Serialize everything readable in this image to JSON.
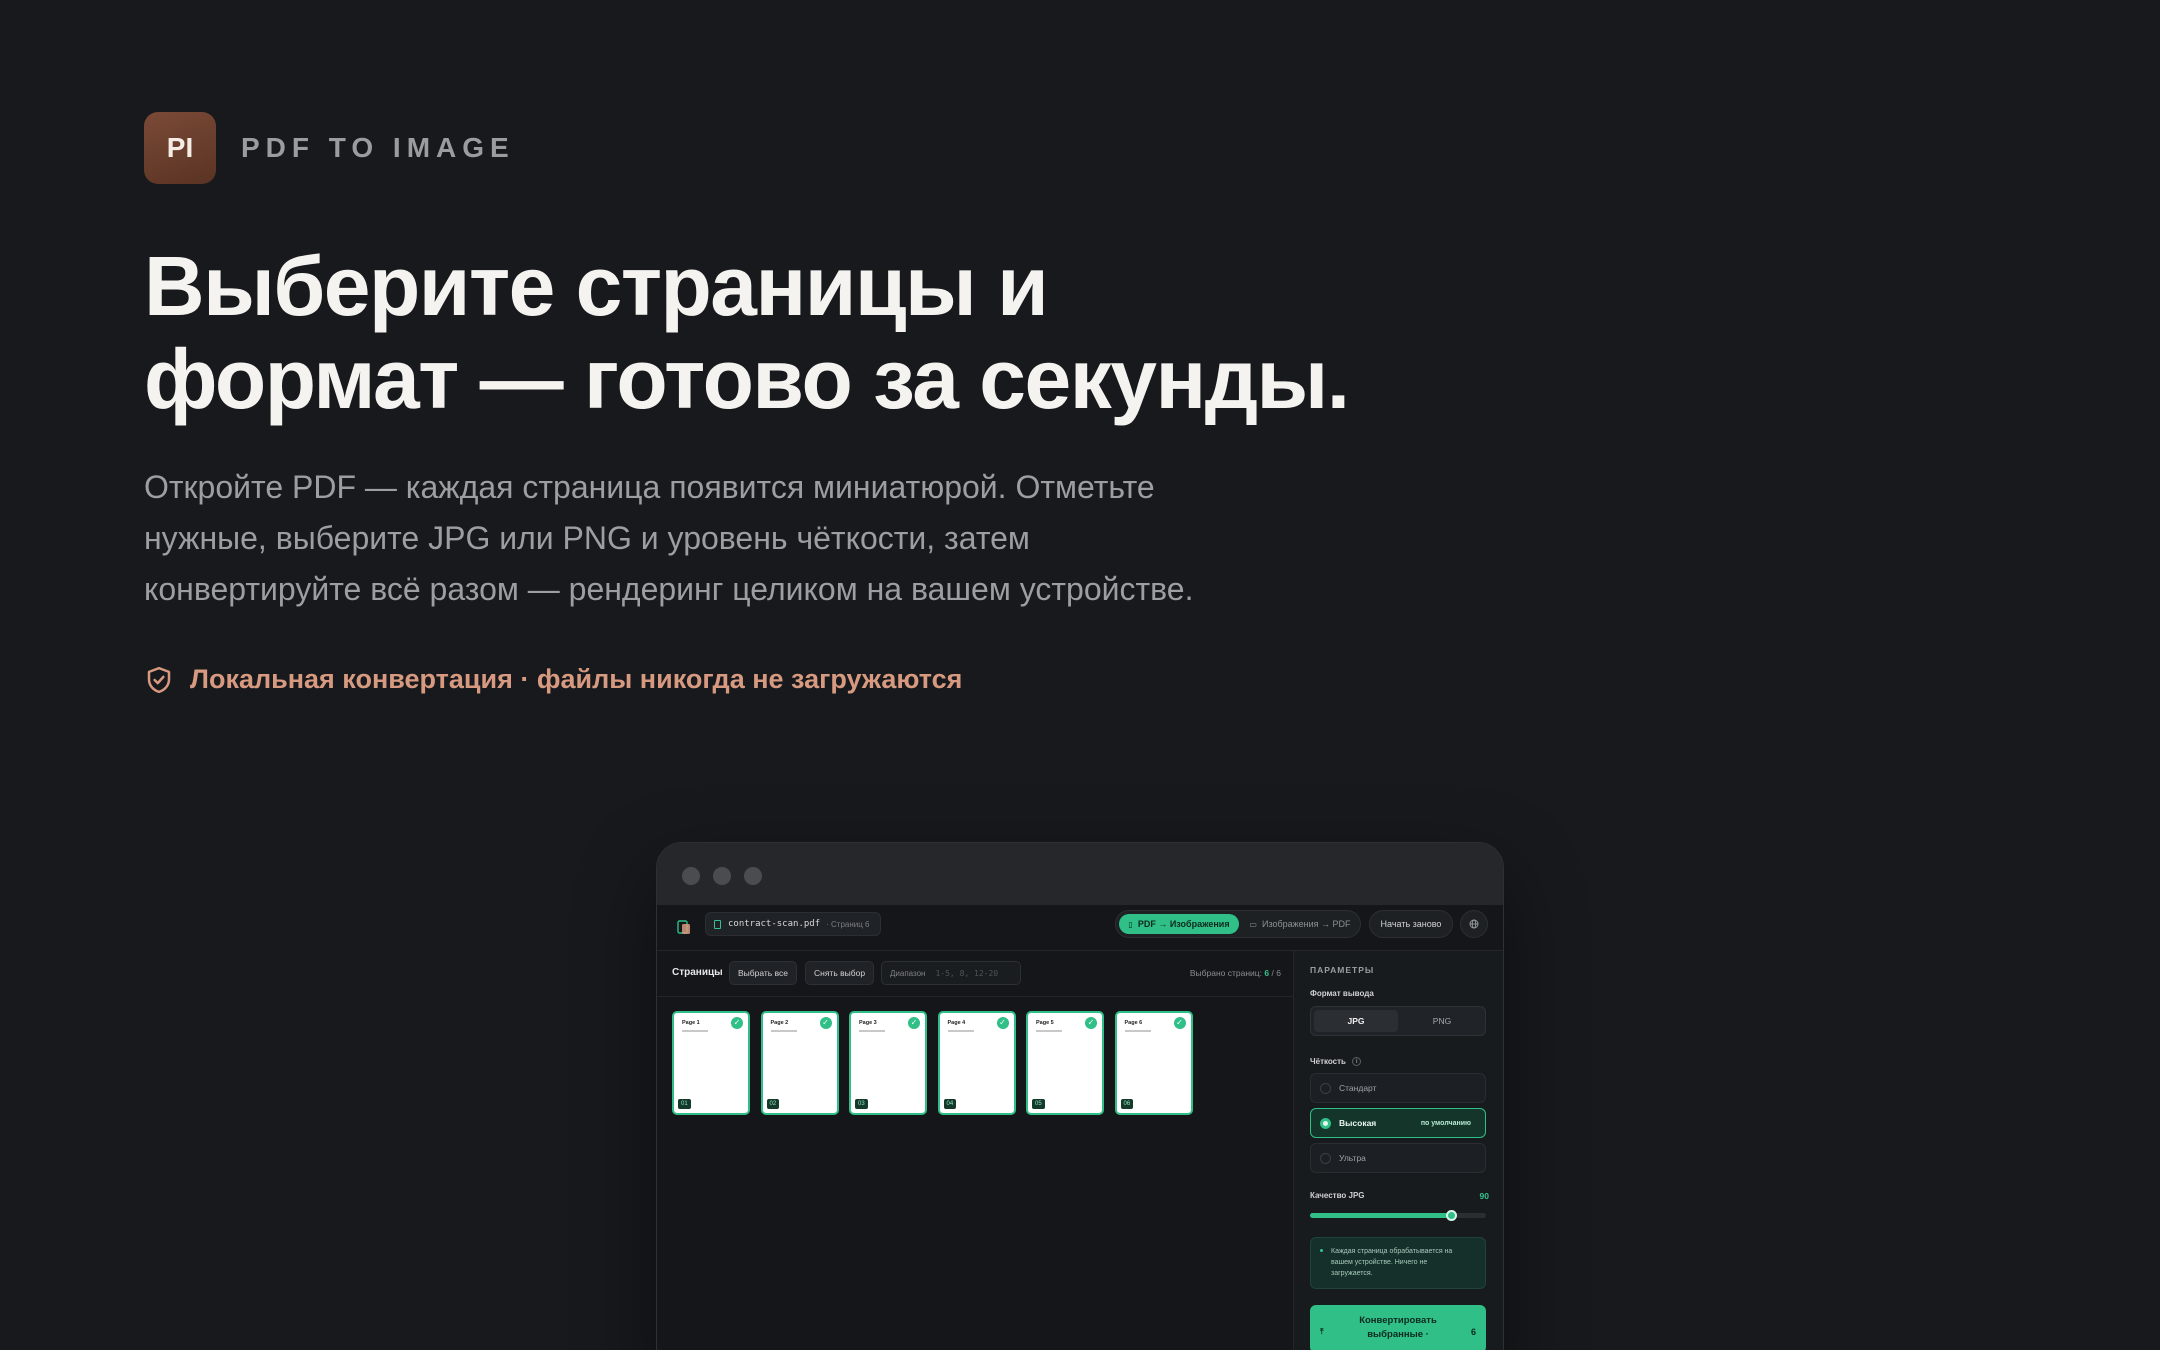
{
  "brand": {
    "badge": "PI",
    "name": "PDF TO IMAGE"
  },
  "hero": {
    "headline_line1": "Выберите страницы и",
    "headline_line2": "формат — готово за секунды.",
    "subtitle_line1": "Откройте PDF — каждая страница появится миниатюрой. Отметьте",
    "subtitle_line2": "нужные, выберите JPG или PNG и уровень чёткости, затем",
    "subtitle_line3": "конвертируйте всё разом — рендеринг целиком на вашем устройстве.",
    "privacy_note": "Локальная конвертация · файлы никогда не загружаются"
  },
  "colors": {
    "accent": "#2fbf87",
    "brand": "#6b3f2d",
    "privacy_text": "#d79a80",
    "background": "#17191c"
  },
  "app": {
    "file_name": "contract-scan.pdf",
    "file_pages": "· Страниц 6",
    "mode_active": "PDF → Изображения",
    "mode_inactive": "Изображения → PDF",
    "restart": "Начать заново",
    "globe_icon": "globe-icon",
    "pages": {
      "title": "Страницы",
      "select_all": "Выбрать все",
      "deselect": "Снять выбор",
      "range_label": "Диапазон",
      "range_placeholder": "1-5, 8, 12-20",
      "selected_label": "Выбрано страниц:",
      "selected_count": "6",
      "selected_sep": "/",
      "total": "6",
      "thumbs": [
        {
          "title": "Page 1",
          "num": "01"
        },
        {
          "title": "Page 2",
          "num": "02"
        },
        {
          "title": "Page 3",
          "num": "03"
        },
        {
          "title": "Page 4",
          "num": "04"
        },
        {
          "title": "Page 5",
          "num": "05"
        },
        {
          "title": "Page 6",
          "num": "06"
        }
      ]
    },
    "settings": {
      "heading": "ПАРАМЕТРЫ",
      "format_label": "Формат вывода",
      "format_jpg": "JPG",
      "format_png": "PNG",
      "format_selected": "JPG",
      "clarity_label": "Чёткость",
      "clarity_info": "i",
      "clarity_options": [
        "Стандарт",
        "Высокая",
        "Ультра"
      ],
      "clarity_selected": "Высокая",
      "default_tag": "по умолчанию",
      "quality_label": "Качество JPG",
      "quality_value": "90",
      "quality_fraction": 0.8,
      "note_line1": "Каждая страница обрабатывается на",
      "note_line2": "вашем устройстве. Ничего не",
      "note_line3": "загружается.",
      "convert_line1": "Конвертировать",
      "convert_line2": "выбранные ·",
      "convert_count": "6",
      "convert_icon": "upload-icon"
    }
  }
}
